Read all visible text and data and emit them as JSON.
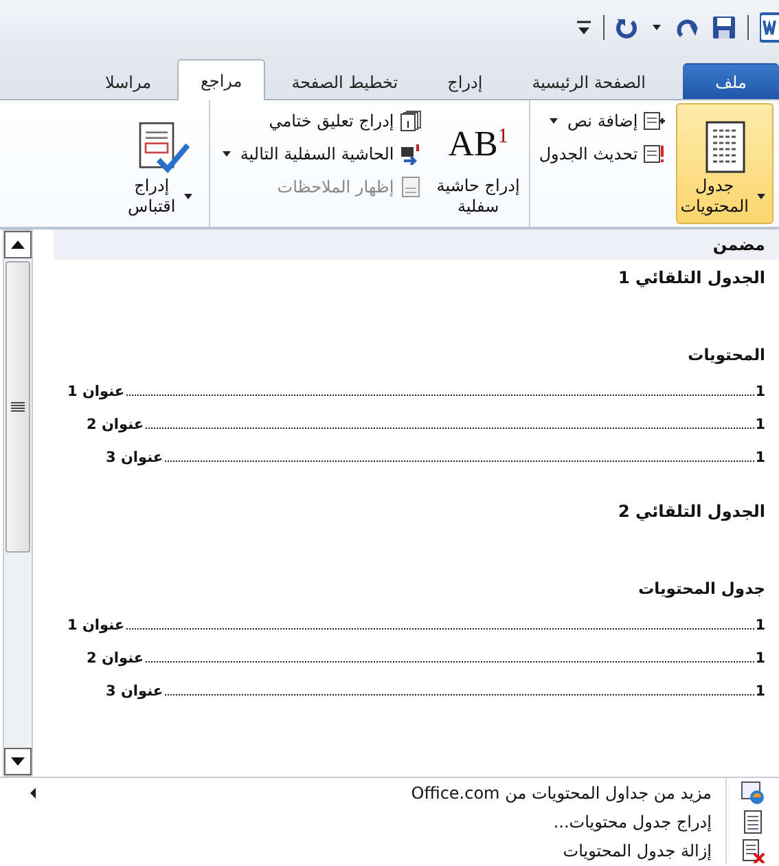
{
  "tabs": [
    {
      "label": "ملف",
      "kind": "file",
      "selected": false
    },
    {
      "label": "الصفحة الرئيسية",
      "kind": "tab",
      "selected": false
    },
    {
      "label": "إدراج",
      "kind": "tab",
      "selected": false
    },
    {
      "label": "تخطيط الصفحة",
      "kind": "tab",
      "selected": false
    },
    {
      "label": "مراجع",
      "kind": "tab",
      "selected": true
    },
    {
      "label": "مراسلا",
      "kind": "tab",
      "selected": false
    }
  ],
  "ribbon_groups": [
    {
      "items": [
        {
          "kind": "large",
          "lines": [
            "جدول",
            "المحتويات"
          ],
          "dropdown": true,
          "pressed": true
        },
        {
          "kind": "stack",
          "items": [
            {
              "label": "إضافة نص",
              "dropdown": true,
              "disabled": false
            },
            {
              "label": "تحديث الجدول",
              "dropdown": false,
              "disabled": false
            }
          ]
        }
      ]
    },
    {
      "items": [
        {
          "kind": "large",
          "icon_text": "AB",
          "icon_sup": "1",
          "lines": [
            "إدراج حاشية",
            "سفلية"
          ],
          "dropdown": false,
          "pressed": false
        },
        {
          "kind": "stack",
          "items": [
            {
              "label": "إدراج تعليق ختامي",
              "dropdown": false,
              "disabled": false
            },
            {
              "label": "الحاشية السفلية التالية",
              "dropdown": true,
              "disabled": false
            },
            {
              "label": "إظهار الملاحظات",
              "dropdown": false,
              "disabled": true
            }
          ]
        }
      ]
    },
    {
      "items": [
        {
          "kind": "large",
          "lines": [
            "إدراج",
            "اقتباس"
          ],
          "dropdown": true,
          "pressed": false
        }
      ]
    }
  ],
  "gallery": {
    "header": "مضمن",
    "entries": [
      {
        "title": "الجدول التلقائي 1",
        "heading": "المحتويات",
        "toc": [
          {
            "text": "عنوان 1",
            "page": "1",
            "children": [
              {
                "text": "عنوان 2",
                "page": "1",
                "children": [
                  {
                    "text": "عنوان 3",
                    "page": "1"
                  }
                ]
              }
            ]
          }
        ]
      },
      {
        "title": "الجدول التلقائي 2",
        "heading": "جدول المحتويات",
        "toc": [
          {
            "text": "عنوان 1",
            "page": "1",
            "children": [
              {
                "text": "عنوان 2",
                "page": "1",
                "children": [
                  {
                    "text": "عنوان 3",
                    "page": "1"
                  }
                ]
              }
            ]
          }
        ]
      }
    ]
  },
  "menu": [
    {
      "label": "مزيد من جداول المحتويات من Office.com",
      "submenu": true
    },
    {
      "label": "إدراج جدول محتويات...",
      "submenu": false
    },
    {
      "label": "إزالة جدول المحتويات",
      "submenu": false
    }
  ]
}
